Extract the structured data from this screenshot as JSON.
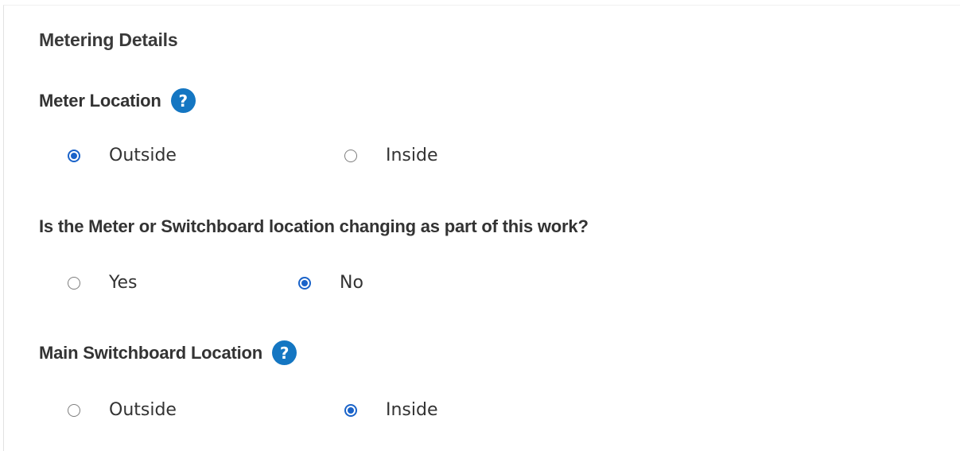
{
  "section": {
    "title": "Metering Details"
  },
  "questions": [
    {
      "label": "Meter Location",
      "has_help": true,
      "options": [
        {
          "label": "Outside",
          "checked": true
        },
        {
          "label": "Inside",
          "checked": false
        }
      ]
    },
    {
      "label": "Is the Meter or Switchboard location changing as part of this work?",
      "has_help": false,
      "options": [
        {
          "label": "Yes",
          "checked": false
        },
        {
          "label": "No",
          "checked": true
        }
      ]
    },
    {
      "label": "Main Switchboard Location",
      "has_help": true,
      "options": [
        {
          "label": "Outside",
          "checked": false
        },
        {
          "label": "Inside",
          "checked": true
        }
      ]
    }
  ],
  "icons": {
    "help": "question-circle-icon",
    "help_glyph": "?"
  },
  "colors": {
    "accent": "#1a63c9",
    "help_bg": "#1476c2",
    "text": "#333333"
  }
}
